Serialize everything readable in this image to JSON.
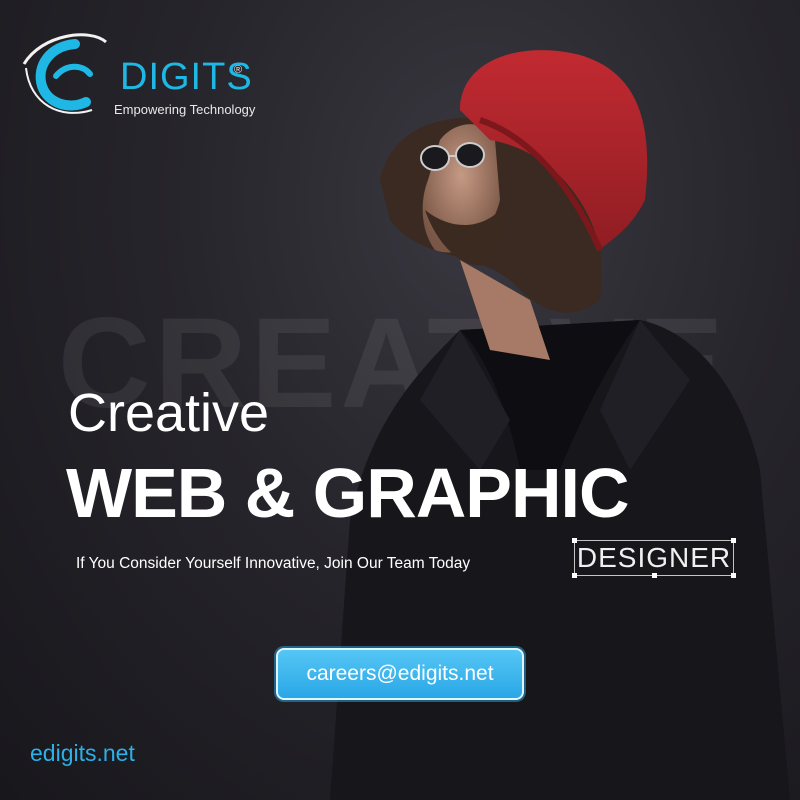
{
  "brand": {
    "name": "DIGITS",
    "registered": "®",
    "tagline": "Empowering Technology"
  },
  "background_word": "CREATIVE",
  "hero": {
    "creative": "Creative",
    "headline": "WEB & GRAPHIC",
    "designer": "DESIGNER",
    "tagline": "If  You Consider Yourself Innovative, Join Our Team Today"
  },
  "cta": {
    "email": "careers@edigits.net"
  },
  "footer": {
    "url": "edigits.net"
  },
  "colors": {
    "accent": "#1fb8e4",
    "button": "#3bb5ee",
    "beanie": "#b3252c",
    "background": "#26252b"
  },
  "icons": [
    "edigits-logo-icon"
  ]
}
